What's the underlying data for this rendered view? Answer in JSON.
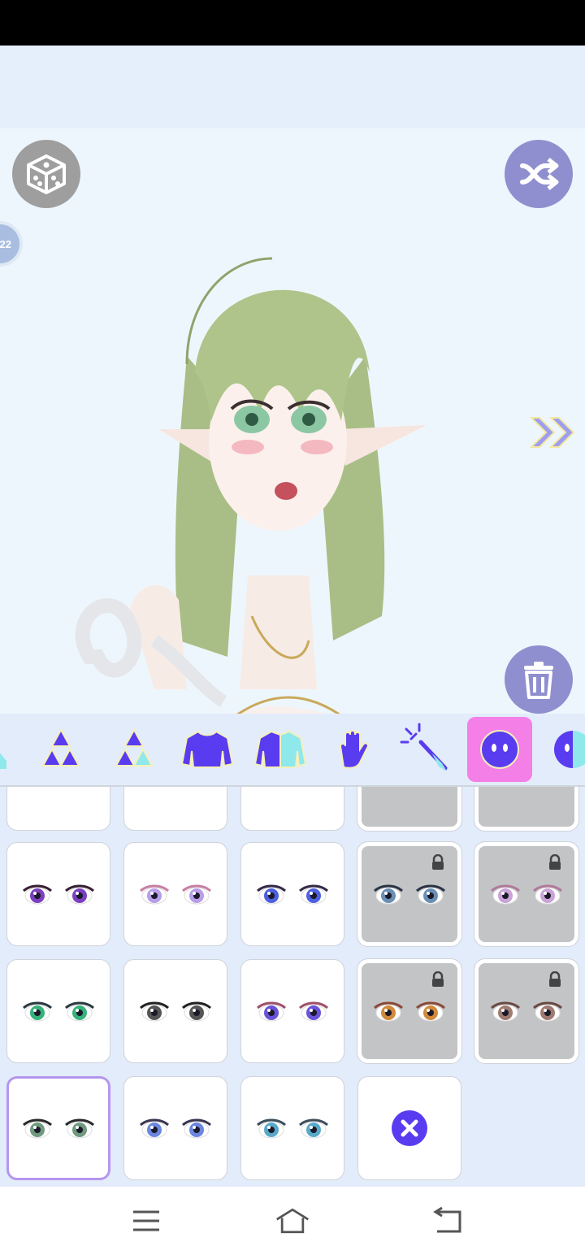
{
  "app": {
    "level_badge": "22"
  },
  "colors": {
    "accent": "#5a3cf0",
    "active_tab": "#f47fe6",
    "button_purple": "#8f8fcf",
    "button_gray": "#9e9e9e",
    "panel_bg": "#e3ecfa",
    "stage_bg": "#eef6fd"
  },
  "toolbar": {
    "top_left": {
      "icon": "dice-icon"
    },
    "top_right": {
      "icon": "shuffle-icon"
    },
    "bottom_right": {
      "icon": "trash-icon"
    },
    "next": {
      "icon": "double-chevron-right-icon"
    }
  },
  "tabs": [
    {
      "icon": "triangle-partial-icon",
      "active": false
    },
    {
      "icon": "triangles-icon",
      "active": false
    },
    {
      "icon": "triangles-alt-icon",
      "active": false
    },
    {
      "icon": "sweater-icon",
      "active": false
    },
    {
      "icon": "jacket-icon",
      "active": false
    },
    {
      "icon": "hand-icon",
      "active": false
    },
    {
      "icon": "wand-icon",
      "active": false
    },
    {
      "icon": "face-eyes-icon",
      "active": true
    },
    {
      "icon": "face-half-icon",
      "active": false
    }
  ],
  "eye_options": [
    {
      "iris": "#7b3fbf",
      "lash": "#3a2036",
      "locked": false,
      "selected": false
    },
    {
      "iris": "#b89ee8",
      "lash": "#c77fa3",
      "locked": false,
      "selected": false
    },
    {
      "iris": "#4e5fe0",
      "lash": "#352a48",
      "locked": false,
      "selected": false
    },
    {
      "iris": "#6a8fb5",
      "lash": "#2b3545",
      "locked": true,
      "selected": false
    },
    {
      "iris": "#c9a3d6",
      "lash": "#b07a9a",
      "locked": true,
      "selected": false
    },
    {
      "iris": "#35b27a",
      "lash": "#2b3a40",
      "locked": false,
      "selected": false
    },
    {
      "iris": "#555555",
      "lash": "#222222",
      "locked": false,
      "selected": false
    },
    {
      "iris": "#6a52d9",
      "lash": "#a0506a",
      "locked": false,
      "selected": false
    },
    {
      "iris": "#d08a3a",
      "lash": "#8a4a3a",
      "locked": true,
      "selected": false
    },
    {
      "iris": "#a07a70",
      "lash": "#6a4a44",
      "locked": true,
      "selected": false
    },
    {
      "iris": "#6f9a7e",
      "lash": "#2a2a2a",
      "locked": false,
      "selected": true
    },
    {
      "iris": "#6b86e0",
      "lash": "#3a3550",
      "locked": false,
      "selected": false
    },
    {
      "iris": "#58a9c9",
      "lash": "#3c4e5a",
      "locked": false,
      "selected": false
    },
    {
      "none": true
    }
  ]
}
